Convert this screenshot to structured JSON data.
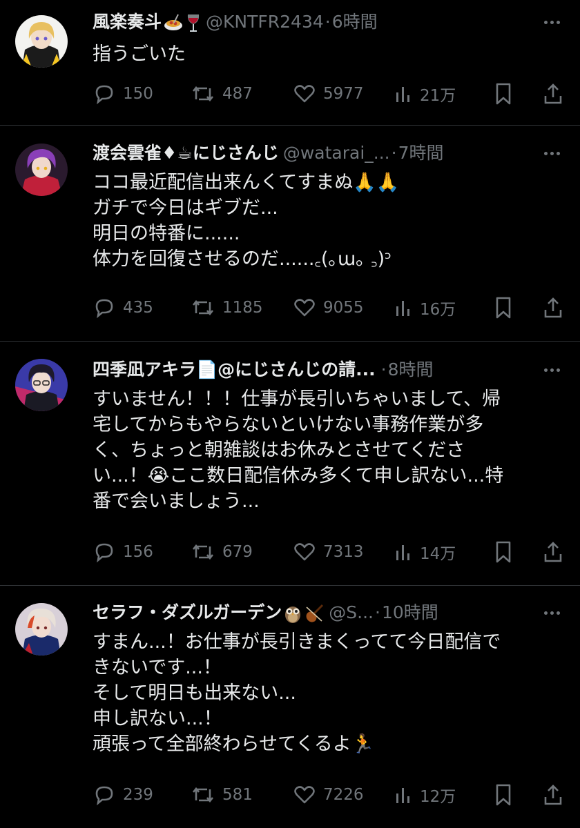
{
  "colors": {
    "background": "#000000",
    "text": "#e7e9ea",
    "secondary": "#71767b",
    "divider": "#2f3336"
  },
  "tweets": [
    {
      "name": "風楽奏斗",
      "name_emojis": [
        "spaghetti-emoji",
        "wine-glass-emoji"
      ],
      "handle": "@KNTFR2434",
      "time": "6時間",
      "lines": [
        "指うごいた"
      ],
      "replies": "150",
      "retweets": "487",
      "likes": "5977",
      "views": "21万"
    },
    {
      "name": "渡会雲雀♦☕にじさんじ",
      "name_emojis": [],
      "handle": "@watarai_...",
      "time": "7時間",
      "lines": [
        "ココ最近配信出来んくてすまぬ🙏🙏",
        "ガチで今日はギブだ...",
        "明日の特番に......",
        "体力を回復させるのだ......꜀(｡ɯ｡ ꜆)ᵓ"
      ],
      "replies": "435",
      "retweets": "1185",
      "likes": "9055",
      "views": "16万"
    },
    {
      "name": "四季凪アキラ📄@にじさんじの請...",
      "name_emojis": [],
      "handle": "",
      "time": "8時間",
      "lines": [
        "すいません！！！仕事が長引いちゃいまして、帰",
        "宅してからもやらないといけない事務作業が多",
        "く、ちょっと朝雑談はお休みとさせてくださ",
        "い...！😭ここ数日配信休み多くて申し訳ない...特",
        "番で会いましょう..."
      ],
      "replies": "156",
      "retweets": "679",
      "likes": "7313",
      "views": "14万"
    },
    {
      "name": "セラフ・ダズルガーデン",
      "name_emojis": [
        "owl-emoji",
        "violin-emoji"
      ],
      "handle": "@S...",
      "time": "10時間",
      "lines": [
        "すまん...！お仕事が長引きまくってて今日配信で",
        "きないです...！",
        "そして明日も出来ない...",
        "申し訳ない...！",
        "頑張って全部終わらせてくるよ🏃"
      ],
      "replies": "239",
      "retweets": "581",
      "likes": "7226",
      "views": "12万"
    }
  ]
}
